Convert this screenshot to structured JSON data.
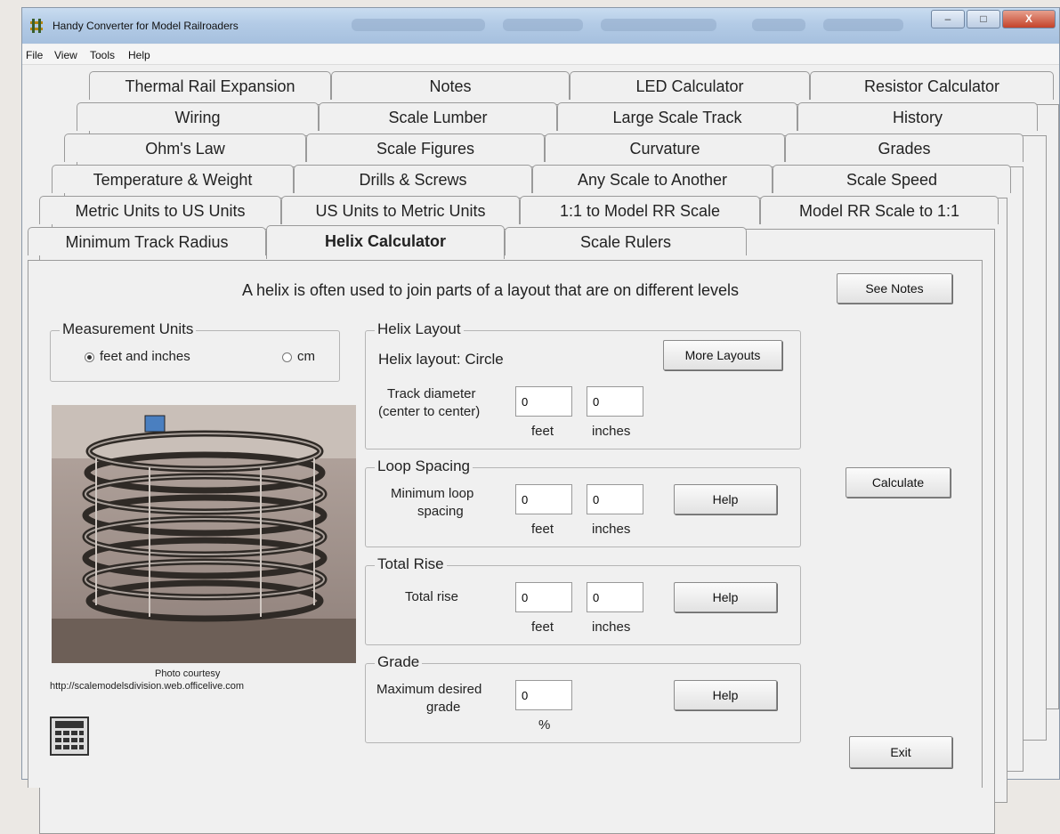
{
  "window": {
    "title": "Handy Converter for Model Railroaders",
    "minimize": "–",
    "maximize": "□",
    "close": "X"
  },
  "menu": [
    "File",
    "View",
    "Tools",
    "Help"
  ],
  "tab_rows": [
    [
      "Thermal Rail Expansion",
      "Notes",
      "LED Calculator",
      "Resistor Calculator"
    ],
    [
      "Wiring",
      "Scale Lumber",
      "Large Scale Track",
      "History"
    ],
    [
      "Ohm's Law",
      "Scale Figures",
      "Curvature",
      "Grades"
    ],
    [
      "Temperature & Weight",
      "Drills & Screws",
      "Any Scale to Another",
      "Scale Speed"
    ],
    [
      "Metric Units to US Units",
      "US Units to Metric Units",
      "1:1 to Model RR Scale",
      "Model RR Scale to 1:1"
    ],
    [
      "Minimum Track Radius",
      "Helix Calculator",
      "Scale Rulers"
    ]
  ],
  "active_tab": "Helix Calculator",
  "page": {
    "description": "A helix is often used to join parts of a layout that are on different levels",
    "see_notes": "See Notes",
    "calculate": "Calculate",
    "exit": "Exit"
  },
  "units": {
    "title": "Measurement Units",
    "option_feet": "feet and inches",
    "option_cm": "cm",
    "selected": "feet and inches"
  },
  "photo": {
    "caption1": "Photo courtesy",
    "caption2": "http://scalemodelsdivision.web.officelive.com"
  },
  "helix_layout": {
    "title": "Helix Layout",
    "layout_text": "Helix layout: Circle",
    "more_layouts": "More Layouts",
    "diameter_label1": "Track diameter",
    "diameter_label2": "(center to center)",
    "feet_value": "0",
    "inches_value": "0",
    "feet_unit": "feet",
    "inches_unit": "inches"
  },
  "loop_spacing": {
    "title": "Loop Spacing",
    "label1": "Minimum loop",
    "label2": "spacing",
    "feet_value": "0",
    "inches_value": "0",
    "feet_unit": "feet",
    "inches_unit": "inches",
    "help": "Help"
  },
  "total_rise": {
    "title": "Total Rise",
    "label": "Total rise",
    "feet_value": "0",
    "inches_value": "0",
    "feet_unit": "feet",
    "inches_unit": "inches",
    "help": "Help"
  },
  "grade": {
    "title": "Grade",
    "label1": "Maximum desired",
    "label2": "grade",
    "value": "0",
    "unit": "%",
    "help": "Help"
  }
}
